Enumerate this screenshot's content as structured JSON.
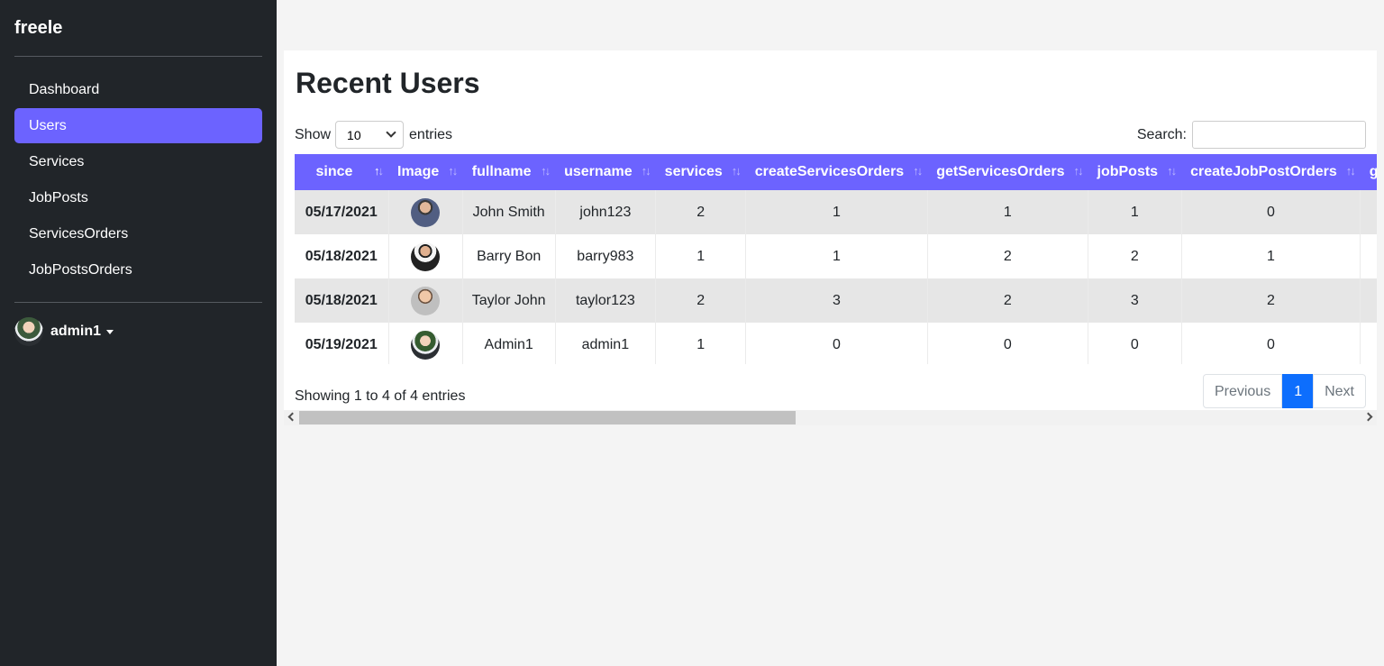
{
  "brand": "freele",
  "sidebar": {
    "items": [
      {
        "label": "Dashboard",
        "active": false
      },
      {
        "label": "Users",
        "active": true
      },
      {
        "label": "Services",
        "active": false
      },
      {
        "label": "JobPosts",
        "active": false
      },
      {
        "label": "ServicesOrders",
        "active": false
      },
      {
        "label": "JobPostsOrders",
        "active": false
      }
    ],
    "user": {
      "name": "admin1"
    }
  },
  "main": {
    "title": "Recent Users",
    "length": {
      "show": "Show",
      "value": "10",
      "entries": "entries"
    },
    "search": {
      "label": "Search:",
      "value": ""
    },
    "table": {
      "columns": [
        "since",
        "Image",
        "fullname",
        "username",
        "services",
        "createServicesOrders",
        "getServicesOrders",
        "jobPosts",
        "createJobPostOrders",
        "getJobPostOrders"
      ],
      "rows": [
        {
          "since": "05/17/2021",
          "fullname": "John Smith",
          "username": "john123",
          "services": "2",
          "createServicesOrders": "1",
          "getServicesOrders": "1",
          "jobPosts": "1",
          "createJobPostOrders": "0"
        },
        {
          "since": "05/18/2021",
          "fullname": "Barry Bon",
          "username": "barry983",
          "services": "1",
          "createServicesOrders": "1",
          "getServicesOrders": "2",
          "jobPosts": "2",
          "createJobPostOrders": "1"
        },
        {
          "since": "05/18/2021",
          "fullname": "Taylor John",
          "username": "taylor123",
          "services": "2",
          "createServicesOrders": "3",
          "getServicesOrders": "2",
          "jobPosts": "3",
          "createJobPostOrders": "2"
        },
        {
          "since": "05/19/2021",
          "fullname": "Admin1",
          "username": "admin1",
          "services": "1",
          "createServicesOrders": "0",
          "getServicesOrders": "0",
          "jobPosts": "0",
          "createJobPostOrders": "0"
        }
      ]
    },
    "info": "Showing 1 to 4 of 4 entries",
    "pagination": {
      "previous": "Previous",
      "current": "1",
      "next": "Next"
    }
  },
  "colors": {
    "accent": "#6c63ff",
    "sidebar_bg": "#212529",
    "page_active": "#0d6efd"
  }
}
